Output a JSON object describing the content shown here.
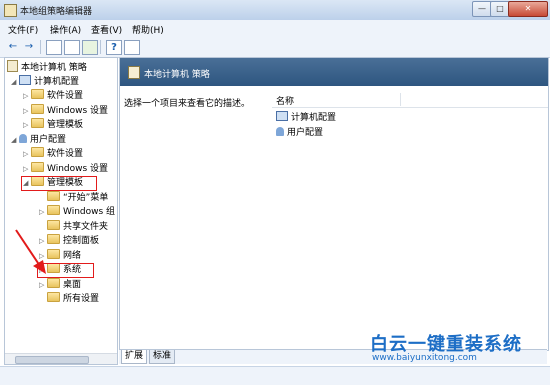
{
  "window": {
    "title": "本地组策略编辑器",
    "minimize": "—",
    "maximize": "□",
    "close": "✕"
  },
  "menu": [
    "文件(F)",
    "操作(A)",
    "查看(V)",
    "帮助(H)"
  ],
  "toolbar": {
    "back": "←",
    "forward": "→",
    "help": "?"
  },
  "tree": {
    "root": "本地计算机 策略",
    "computer_config": "计算机配置",
    "cc_software": "软件设置",
    "cc_windows": "Windows 设置",
    "cc_admin": "管理模板",
    "user_config": "用户配置",
    "uc_software": "软件设置",
    "uc_windows": "Windows 设置",
    "uc_admin": "管理模板",
    "start_menu": "“开始”菜单",
    "windows_components": "Windows 组",
    "shared_folders": "共享文件夹",
    "control_panel": "控制面板",
    "network": "网络",
    "system": "系统",
    "desktop": "桌面",
    "all_settings": "所有设置"
  },
  "right": {
    "header": "本地计算机 策略",
    "description": "选择一个项目来查看它的描述。",
    "column_name": "名称",
    "items": [
      "计算机配置",
      "用户配置"
    ]
  },
  "tabs": [
    "扩展",
    "标准"
  ],
  "watermark": {
    "title": "白云一键重装系统",
    "url": "www.baiyunxitong.com"
  },
  "colors": {
    "header_bg": "#2e5680",
    "highlight": "#e21b1b",
    "watermark": "#1d6ec6"
  }
}
